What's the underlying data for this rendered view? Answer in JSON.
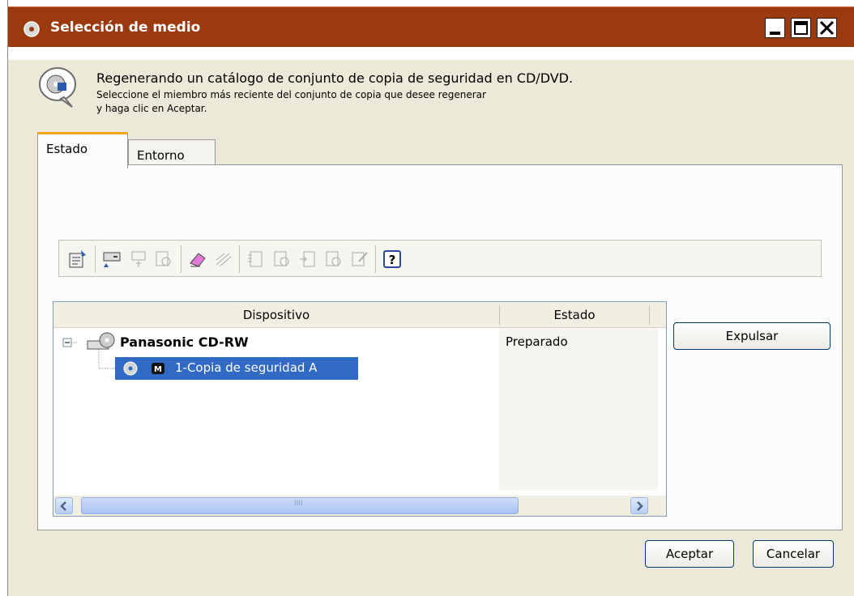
{
  "window": {
    "title": "Selección de medio"
  },
  "header": {
    "line1": "Regenerando un catálogo de conjunto de copia de seguridad en CD/DVD.",
    "line2": "Seleccione el miembro más reciente del conjunto de copia que desee regenerar",
    "line3": "y haga clic en Aceptar."
  },
  "tabs": [
    {
      "label": "Estado"
    },
    {
      "label": "Entorno"
    }
  ],
  "toolbar": {
    "icons": [
      "properties-icon",
      "device-action-icon",
      "device-icon",
      "media-icon",
      "erase-icon",
      "format-icon",
      "catalog-icon",
      "media-catalog-icon",
      "export-icon",
      "import-icon",
      "edit-icon",
      "help-icon"
    ]
  },
  "list": {
    "columns": [
      "Dispositivo",
      "Estado"
    ],
    "device": {
      "name": "Panasonic CD-RW",
      "status": "Preparado"
    },
    "member": {
      "label": "1-Copia de seguridad A"
    },
    "scroll_thumb_text": "IIII"
  },
  "buttons": {
    "eject": "Expulsar",
    "ok": "Aceptar",
    "cancel": "Cancelar"
  },
  "colors": {
    "titlebar": "#9b3a0f",
    "selection": "#316ac5",
    "tab_accent": "#f6a41a"
  }
}
